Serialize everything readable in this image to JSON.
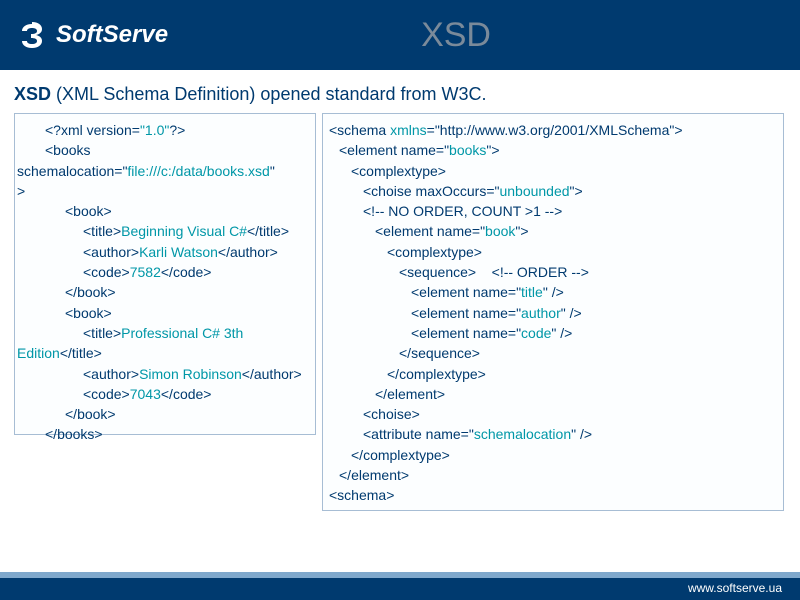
{
  "header": {
    "brand": "SoftServe",
    "title": "XSD"
  },
  "intro": {
    "bold": "XSD",
    "rest": " (XML Schema Definition) opened standard from W3C."
  },
  "left": {
    "l1": "<?xml version=",
    "l1v": "\"1.0\"",
    "l1e": "?>",
    "l2": "<books",
    "l3a": "schemalocation=\"",
    "l3v": "file:///c:/data/books.xsd",
    "l3b": "\"",
    "l4": ">",
    "l5": "<book>",
    "l6a": "<title>",
    "l6v": "Beginning Visual C#",
    "l6b": "</title>",
    "l7a": "<author>",
    "l7v": "Karli Watson",
    "l7b": "</author>",
    "l8a": "<code>",
    "l8v": "7582",
    "l8b": "</code>",
    "l9": "</book>",
    "l10": "<book>",
    "l11a": "<title>",
    "l11v": "Professional C# 3th Edition",
    "l11b": "</title>",
    "l12a": "<author>",
    "l12v": "Simon Robinson",
    "l12b": "</author>",
    "l13a": "<code>",
    "l13v": "7043",
    "l13b": "</code>",
    "l14": "</book>",
    "l15": "</books>"
  },
  "right": {
    "r1a": "<schema ",
    "r1k": "xmlns",
    "r1b": "=\"http://www.w3.org/2001/XMLSchema\">",
    "r2a": "<element name=\"",
    "r2v": "books",
    "r2b": "\">",
    "r3": "<complextype>",
    "r4a": "<choise maxOccurs=\"",
    "r4v": "unbounded",
    "r4b": "\">",
    "r5": "<!-- NO ORDER, COUNT >1 -->",
    "r6a": "<element name=\"",
    "r6v": "book",
    "r6b": "\">",
    "r7": "<complextype>",
    "r8a": "<sequence>",
    "r8c": "<!-- ORDER -->",
    "r9a": "<element name=\"",
    "r9v": "title",
    "r9b": "\" />",
    "r10a": "<element name=\"",
    "r10v": "author",
    "r10b": "\" />",
    "r11a": "<element name=\"",
    "r11v": "code",
    "r11b": "\" />",
    "r12": "</sequence>",
    "r13": "</complextype>",
    "r14": "</element>",
    "r15": "<choise>",
    "r16a": "<attribute name=\"",
    "r16v": "schemalocation",
    "r16b": "\" />",
    "r17": "</complextype>",
    "r18": "</element>",
    "r19": "<schema>"
  },
  "footer": {
    "url": "www.softserve.ua"
  }
}
